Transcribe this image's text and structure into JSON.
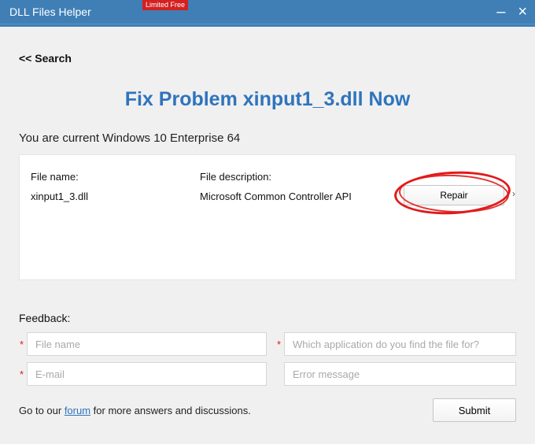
{
  "titlebar": {
    "title": "DLL Files Helper",
    "badge": "Limited Free"
  },
  "nav": {
    "back_label": "<< Search"
  },
  "heading": "Fix Problem xinput1_3.dll Now",
  "os_line": "You are current Windows 10 Enterprise 64",
  "panel": {
    "filename_label": "File name:",
    "filename_value": "xinput1_3.dll",
    "filedesc_label": "File description:",
    "filedesc_value": "Microsoft Common Controller API",
    "repair_label": "Repair"
  },
  "feedback": {
    "section_label": "Feedback:",
    "file_name_placeholder": "File name",
    "app_placeholder": "Which application do you find the file for?",
    "email_placeholder": "E-mail",
    "error_placeholder": "Error message"
  },
  "footer": {
    "prefix": "Go to our ",
    "link": "forum",
    "suffix": " for more answers and discussions.",
    "submit_label": "Submit"
  }
}
